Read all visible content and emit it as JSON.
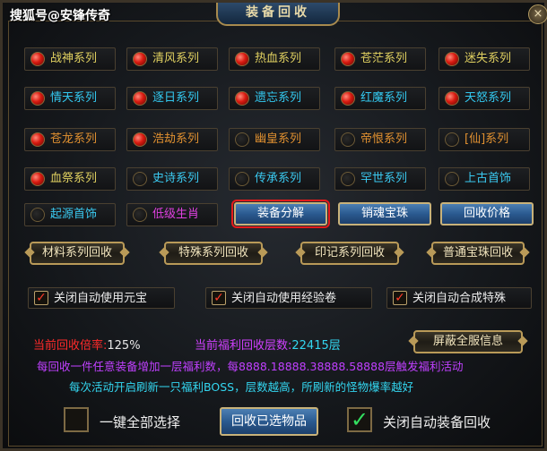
{
  "watermark": "搜狐号@安锋传奇",
  "title": "装备回收",
  "close_glyph": "×",
  "series": [
    {
      "label": "战神系列",
      "on": true,
      "color": "#e0d060"
    },
    {
      "label": "清风系列",
      "on": true,
      "color": "#e0d060"
    },
    {
      "label": "热血系列",
      "on": true,
      "color": "#e0d060"
    },
    {
      "label": "苍茫系列",
      "on": true,
      "color": "#e0d060"
    },
    {
      "label": "迷失系列",
      "on": true,
      "color": "#e0d060"
    },
    {
      "label": "情天系列",
      "on": true,
      "color": "#33c9f0"
    },
    {
      "label": "逐日系列",
      "on": true,
      "color": "#33c9f0"
    },
    {
      "label": "遗忘系列",
      "on": true,
      "color": "#33c9f0"
    },
    {
      "label": "红魔系列",
      "on": true,
      "color": "#33c9f0"
    },
    {
      "label": "天怒系列",
      "on": true,
      "color": "#33c9f0"
    },
    {
      "label": "苍龙系列",
      "on": true,
      "color": "#e09030"
    },
    {
      "label": "浩劫系列",
      "on": true,
      "color": "#e09030"
    },
    {
      "label": "幽皇系列",
      "on": false,
      "color": "#e09030"
    },
    {
      "label": "帝恨系列",
      "on": false,
      "color": "#e09030"
    },
    {
      "label": "[仙]系列",
      "on": false,
      "color": "#e09030"
    },
    {
      "label": "血祭系列",
      "on": true,
      "color": "#e0d060"
    },
    {
      "label": "史诗系列",
      "on": false,
      "color": "#3ac9f0"
    },
    {
      "label": "传承系列",
      "on": false,
      "color": "#3ac9f0"
    },
    {
      "label": "罕世系列",
      "on": false,
      "color": "#3ac9f0"
    },
    {
      "label": "上古首饰",
      "on": false,
      "color": "#3ac9f0"
    },
    {
      "label": "起源首饰",
      "on": false,
      "color": "#3ac9f0"
    },
    {
      "label": "低级生肖",
      "on": false,
      "color": "#e040e0"
    }
  ],
  "blue_buttons": [
    "装备分解",
    "销魂宝珠",
    "回收价格"
  ],
  "gold_buttons": [
    "材料系列回收",
    "特殊系列回收",
    "印记系列回收",
    "普通宝珠回收"
  ],
  "checks": [
    {
      "label": "关闭自动使用元宝",
      "checked": true
    },
    {
      "label": "关闭自动使用经验卷",
      "checked": true
    },
    {
      "label": "关闭自动合成特殊",
      "checked": true
    }
  ],
  "check_glyph": "✓",
  "info": {
    "rate_label": "当前回收倍率:",
    "rate_value": "125%",
    "welfare_label": "当前福利回收层数:",
    "welfare_value": "22415层",
    "shield_button": "屏蔽全服信息",
    "line1": "每回收一件任意装备增加一层福利数，每8888.18888.38888.58888层触发福利活动",
    "line2": "每次活动开启刷新一只福利BOSS，层数越高，所刷新的怪物爆率越好"
  },
  "bottom": {
    "select_all": "一键全部选择",
    "recycle_selected": "回收已选物品",
    "close_auto_recycle": "关闭自动装备回收",
    "close_auto_recycle_checked": true,
    "select_all_checked": false
  },
  "colors": {
    "rate_label": "#ff2a2a",
    "rate_value": "#e8e8e8",
    "welfare_label": "#d040ff",
    "welfare_value": "#33d6f0",
    "line1": "#c040ff",
    "line2": "#33d6f0"
  }
}
